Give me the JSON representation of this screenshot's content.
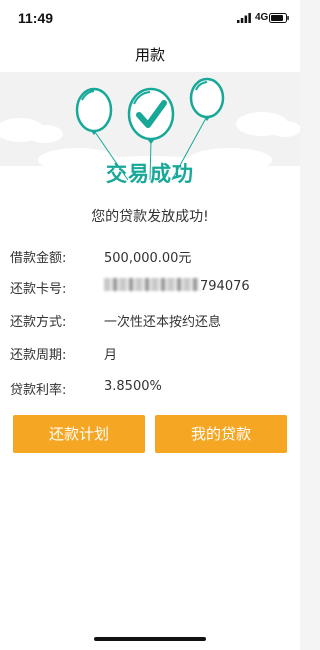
{
  "status_bar": {
    "time": "11:49",
    "network": "4G",
    "icons": [
      "signal-icon",
      "battery-icon"
    ]
  },
  "nav": {
    "title": "用款"
  },
  "hero": {
    "title": "交易成功",
    "icons": [
      "balloon-icon",
      "check-icon",
      "cloud-icon"
    ],
    "accent_color": "#17a898"
  },
  "result": {
    "message": "您的贷款发放成功!"
  },
  "details": [
    {
      "label": "借款金额:",
      "value": "500,000.00元"
    },
    {
      "label": "还款卡号:",
      "value": "794076"
    },
    {
      "label": "还款方式:",
      "value": "一次性还本按约还息"
    },
    {
      "label": "还款周期:",
      "value": "月"
    },
    {
      "label": "贷款利率:",
      "value": "3.8500%"
    }
  ],
  "buttons": {
    "repayment_plan": "还款计划",
    "my_loans": "我的贷款",
    "button_color": "#f5a623"
  }
}
